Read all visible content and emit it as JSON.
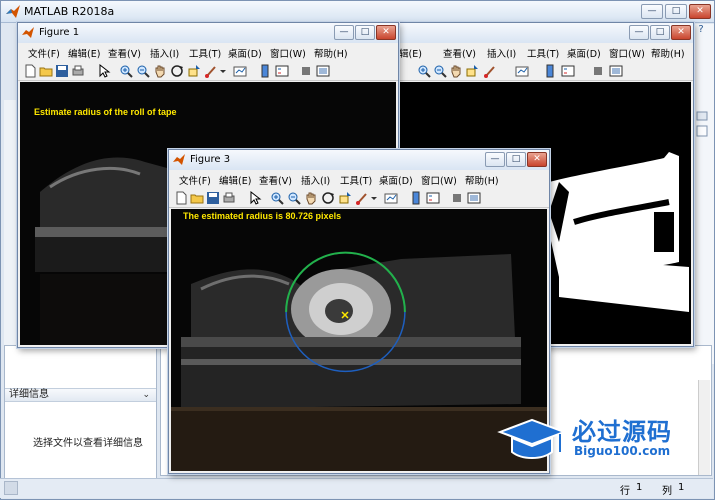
{
  "app": {
    "title": "MATLAB R2018a",
    "brand_color": "#c9452e"
  },
  "window_controls": {
    "minimize": "—",
    "maximize": "□",
    "close": "✕"
  },
  "help_button": "?",
  "details_panel": {
    "header": "详细信息",
    "empty_text": "选择文件以查看详细信息"
  },
  "status": {
    "row_label": "行",
    "row_value": "1",
    "col_label": "列",
    "col_value": "1"
  },
  "figure_menu": [
    "文件(F)",
    "编辑(E)",
    "查看(V)",
    "插入(I)",
    "工具(T)",
    "桌面(D)",
    "窗口(W)",
    "帮助(H)"
  ],
  "figure1": {
    "title": "Figure 1",
    "caption": "Estimate radius of the roll of tape"
  },
  "figure3": {
    "title": "Figure 3",
    "caption": "The estimated radius is 80.726 pixels"
  },
  "figure2": {
    "menu": [
      "辑(E)",
      "查看(V)",
      "插入(I)",
      "工具(T)",
      "桌面(D)",
      "窗口(W)",
      "帮助(H)"
    ]
  },
  "toolbar_icons": [
    "new-file-icon",
    "open-folder-icon",
    "save-icon",
    "print-icon",
    "pointer-icon",
    "zoom-in-icon",
    "zoom-out-icon",
    "pan-hand-icon",
    "rotate-3d-icon",
    "data-cursor-icon",
    "brush-icon",
    "link-plot-icon",
    "insert-colorbar-icon",
    "insert-legend-icon",
    "hide-plot-tools-icon",
    "show-plot-tools-icon"
  ],
  "watermark": {
    "text": "必过源码",
    "sub": "Biguo100.com",
    "color": "#1f6fd1"
  },
  "colors": {
    "caption": "#ffe800",
    "circle_top": "#22b14c",
    "circle_bottom": "#1e5fbf",
    "marker": "#ffe800"
  }
}
